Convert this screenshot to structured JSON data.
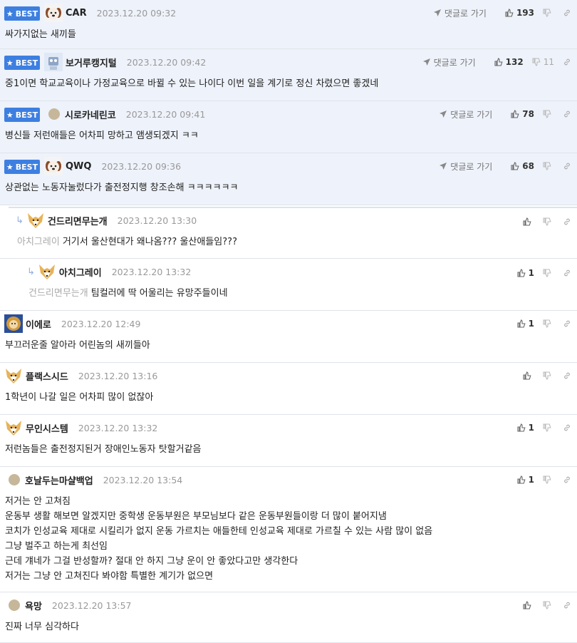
{
  "labels": {
    "best": "BEST",
    "reply_to": "댓글로 가기"
  },
  "colors": {
    "best_badge": "#3d7fe1",
    "best_bg": "#eef2fa",
    "mention": "#aaaaaa"
  },
  "comments": [
    {
      "best": true,
      "nick": "CAR",
      "date": "2023.12.20 09:32",
      "up": "193",
      "down": "",
      "avatar": "dog-avatar",
      "lines": [
        "싸가지없는 새끼들"
      ]
    },
    {
      "best": true,
      "nick": "보거루캥지털",
      "date": "2023.12.20 09:42",
      "up": "132",
      "down": "11",
      "avatar": "robot-avatar",
      "lines": [
        "중1이면 학교교육이나 가정교육으로 바뀔 수 있는 나이다 이번 일을 계기로 정신 차렸으면 좋겠네"
      ]
    },
    {
      "best": true,
      "nick": "시로카네린코",
      "date": "2023.12.20 09:41",
      "up": "78",
      "down": "",
      "avatar": "dot-avatar",
      "lines": [
        "병신들 저런애들은 어차피 망하고 앰생되겠지 ㅋㅋ"
      ]
    },
    {
      "best": true,
      "nick": "QWQ",
      "date": "2023.12.20 09:36",
      "up": "68",
      "down": "",
      "avatar": "dog-avatar",
      "lines": [
        "상관없는 노동자눌렀다가 출전정지행 창조손해 ㅋㅋㅋㅋㅋㅋ"
      ]
    },
    {
      "best": false,
      "nick": "건드리면무는개",
      "date": "2023.12.20 13:30",
      "up": "",
      "down": "",
      "avatar": "fox-avatar",
      "reply": 1,
      "mention": "아치그레이",
      "lines": [
        "거기서 울산현대가 왜나옴??? 울산애들임???"
      ]
    },
    {
      "best": false,
      "nick": "아치그레이",
      "date": "2023.12.20 13:32",
      "up": "1",
      "down": "",
      "avatar": "fox-avatar",
      "reply": 2,
      "mention": "건드리면무는개",
      "lines": [
        "팀컬러에 딱 어울리는 유망주들이네"
      ]
    },
    {
      "best": false,
      "nick": "이에로",
      "date": "2023.12.20 12:49",
      "up": "1",
      "down": "",
      "avatar": "lion-avatar",
      "lines": [
        "부끄러운줄 알아라 어린놈의 새끼들아"
      ]
    },
    {
      "best": false,
      "nick": "플랙스시드",
      "date": "2023.12.20 13:16",
      "up": "",
      "down": "",
      "avatar": "fox-avatar",
      "lines": [
        "1학년이 나갈 일은 어차피 많이 없잖아"
      ]
    },
    {
      "best": false,
      "nick": "무인시스템",
      "date": "2023.12.20 13:32",
      "up": "1",
      "down": "",
      "avatar": "fox-avatar",
      "lines": [
        "저런놈들은 출전정지된거 장애인노동자 탓할거같음"
      ]
    },
    {
      "best": false,
      "nick": "호날두는마샬백업",
      "date": "2023.12.20 13:54",
      "up": "1",
      "down": "",
      "avatar": "dot-avatar",
      "lines": [
        "저거는 안 고쳐짐",
        "운동부 생활 해보면 알겠지만 중학생 운동부원은 부모님보다 같은 운동부원들이랑 더 많이 붙어지냄",
        "코치가 인성교육 제대로 시킬리가 없지 운동 가르치는 애들한테 인성교육 제대로 가르칠 수 있는 사람 많이 없음",
        "그냥 벌주고 하는게 최선임",
        "근데 걔네가 그걸 반성할까? 절대 안 하지 그냥 운이 안 좋았다고만 생각한다",
        "저거는 그냥 안 고쳐진다 봐야함 특별한 계기가 없으면"
      ]
    },
    {
      "best": false,
      "nick": "욕망",
      "date": "2023.12.20 13:57",
      "up": "",
      "down": "",
      "avatar": "dot-avatar",
      "lines": [
        "진짜 너무 심각하다"
      ]
    }
  ]
}
